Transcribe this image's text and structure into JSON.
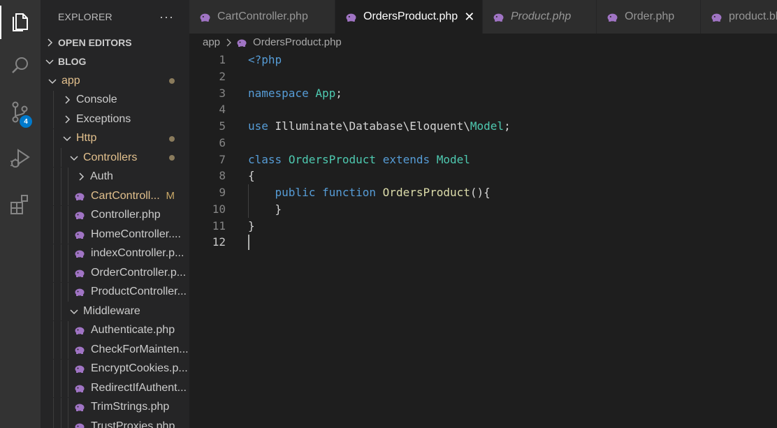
{
  "activity_bar": {
    "items": [
      {
        "icon": "files-icon",
        "active": true
      },
      {
        "icon": "search-icon"
      },
      {
        "icon": "source-control-icon",
        "badge": "4"
      },
      {
        "icon": "run-debug-icon"
      },
      {
        "icon": "extensions-icon"
      }
    ]
  },
  "sidebar": {
    "title": "EXPLORER",
    "more": "···",
    "open_editors": "OPEN EDITORS",
    "project": "BLOG",
    "tree": [
      {
        "label": "app",
        "kind": "folder",
        "open": true,
        "depth": 1,
        "status": "dot",
        "modified": true
      },
      {
        "label": "Console",
        "kind": "folder",
        "open": false,
        "depth": 2
      },
      {
        "label": "Exceptions",
        "kind": "folder",
        "open": false,
        "depth": 2
      },
      {
        "label": "Http",
        "kind": "folder",
        "open": true,
        "depth": 2,
        "status": "dot",
        "modified": true
      },
      {
        "label": "Controllers",
        "kind": "folder",
        "open": true,
        "depth": 3,
        "status": "dot",
        "modified": true
      },
      {
        "label": "Auth",
        "kind": "folder",
        "open": false,
        "depth": 4
      },
      {
        "label": "CartControll...",
        "kind": "file",
        "depth": 4,
        "status": "M",
        "modified": true
      },
      {
        "label": "Controller.php",
        "kind": "file",
        "depth": 4
      },
      {
        "label": "HomeController....",
        "kind": "file",
        "depth": 4
      },
      {
        "label": "indexController.p...",
        "kind": "file",
        "depth": 4
      },
      {
        "label": "OrderController.p...",
        "kind": "file",
        "depth": 4
      },
      {
        "label": "ProductController...",
        "kind": "file",
        "depth": 4
      },
      {
        "label": "Middleware",
        "kind": "folder",
        "open": true,
        "depth": 3
      },
      {
        "label": "Authenticate.php",
        "kind": "file",
        "depth": 4
      },
      {
        "label": "CheckForMainten...",
        "kind": "file",
        "depth": 4
      },
      {
        "label": "EncryptCookies.p...",
        "kind": "file",
        "depth": 4
      },
      {
        "label": "RedirectIfAuthent...",
        "kind": "file",
        "depth": 4
      },
      {
        "label": "TrimStrings.php",
        "kind": "file",
        "depth": 4
      },
      {
        "label": "TrustProxies.php",
        "kind": "file",
        "depth": 4
      }
    ]
  },
  "tabs": [
    {
      "label": "CartController.php"
    },
    {
      "label": "OrdersProduct.php",
      "active": true,
      "close": "✕"
    },
    {
      "label": "Product.php",
      "italic": true
    },
    {
      "label": "Order.php"
    },
    {
      "label": "product.blade.php"
    }
  ],
  "breadcrumb": {
    "folder": "app",
    "file": "OrdersProduct.php"
  },
  "editor": {
    "cursor_line": 12,
    "lines": [
      {
        "n": "1",
        "tokens": [
          {
            "t": "<?php",
            "c": "kw"
          }
        ]
      },
      {
        "n": "2",
        "tokens": []
      },
      {
        "n": "3",
        "tokens": [
          {
            "t": "namespace",
            "c": "kw"
          },
          {
            "t": " "
          },
          {
            "t": "App",
            "c": "cls"
          },
          {
            "t": ";"
          }
        ]
      },
      {
        "n": "4",
        "tokens": []
      },
      {
        "n": "5",
        "tokens": [
          {
            "t": "use",
            "c": "kw"
          },
          {
            "t": " Illuminate\\Database\\Eloquent\\"
          },
          {
            "t": "Model",
            "c": "cls"
          },
          {
            "t": ";"
          }
        ]
      },
      {
        "n": "6",
        "tokens": []
      },
      {
        "n": "7",
        "tokens": [
          {
            "t": "class",
            "c": "kw"
          },
          {
            "t": " "
          },
          {
            "t": "OrdersProduct",
            "c": "cls"
          },
          {
            "t": " "
          },
          {
            "t": "extends",
            "c": "kw"
          },
          {
            "t": " "
          },
          {
            "t": "Model",
            "c": "cls"
          }
        ]
      },
      {
        "n": "8",
        "tokens": [
          {
            "t": "{"
          }
        ]
      },
      {
        "n": "9",
        "tokens": [
          {
            "t": "    "
          },
          {
            "t": "public",
            "c": "kw"
          },
          {
            "t": " "
          },
          {
            "t": "function",
            "c": "kw"
          },
          {
            "t": " "
          },
          {
            "t": "OrdersProduct",
            "c": "fn"
          },
          {
            "t": "(){"
          }
        ]
      },
      {
        "n": "10",
        "tokens": [
          {
            "t": "    }"
          }
        ]
      },
      {
        "n": "11",
        "tokens": [
          {
            "t": "}"
          }
        ]
      },
      {
        "n": "12",
        "tokens": []
      }
    ]
  },
  "colors": {
    "php_icon": "#a074c4",
    "keyword": "#569cd6",
    "type": "#4ec9b0",
    "function": "#dcdcaa",
    "modified": "#e2c08d",
    "badge": "#007acc"
  }
}
